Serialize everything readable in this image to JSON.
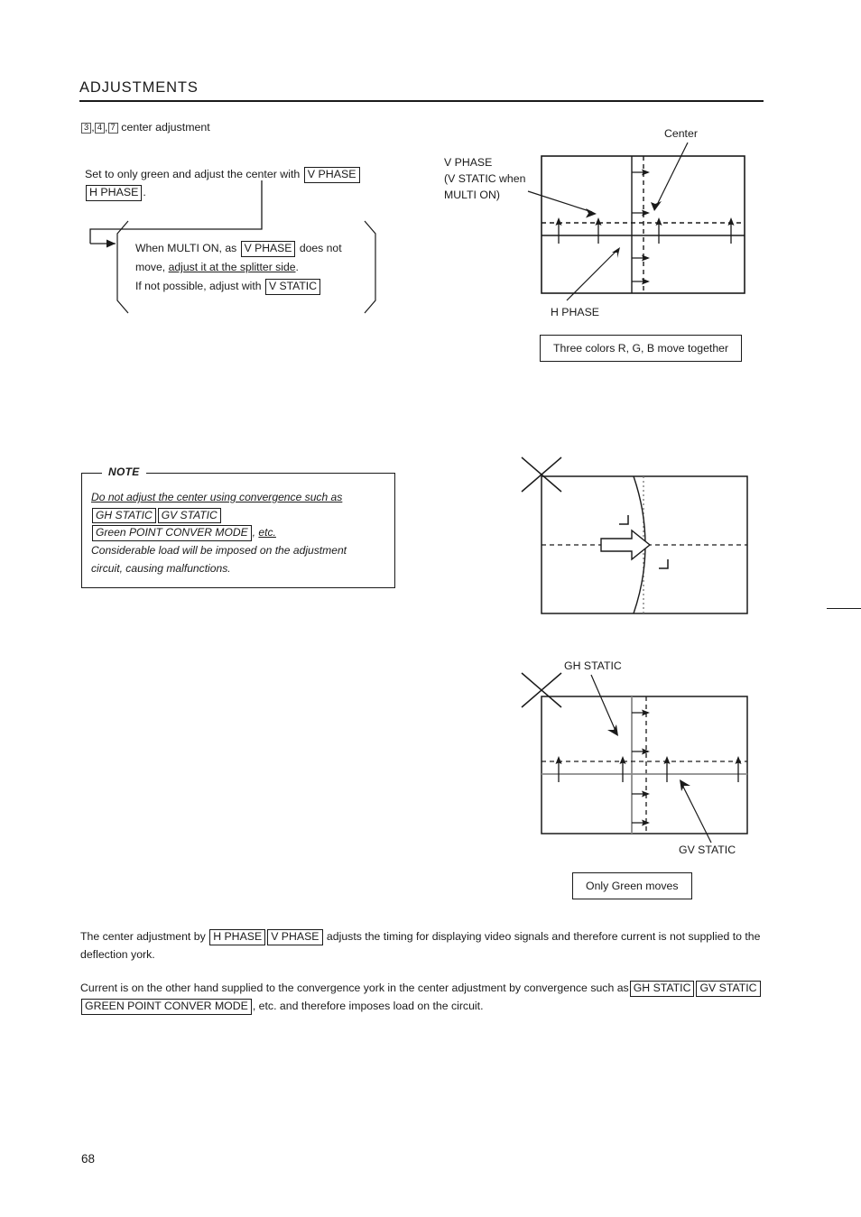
{
  "header": {
    "title": "ADJUSTMENTS"
  },
  "step": {
    "num1": "3",
    "num2": "4",
    "num3": "7",
    "sep": ",",
    "label": "center adjustment"
  },
  "instruction": {
    "lead": "Set to only green and adjust the center with",
    "term_v_phase": "V PHASE",
    "term_h_phase": "H PHASE",
    "period": "."
  },
  "callout": {
    "line1_a": "When MULTI ON, as",
    "line1_term": "V PHASE",
    "line1_b": "does not",
    "line2_a": "move,",
    "line2_underlined": "adjust it at the splitter side",
    "line2_b": ".",
    "line3_a": "If not possible, adjust with",
    "line3_term": "V STATIC"
  },
  "note": {
    "legend": "NOTE",
    "line1": "Do not adjust the center using convergence such as",
    "term1": "GH STATIC",
    "term2": "GV STATIC",
    "term3": "Green POINT CONVER MODE",
    "after_term3": ",",
    "etc": "etc.",
    "line4": "Considerable load will be imposed on the adjustment",
    "line5": "circuit, causing malfunctions."
  },
  "figures": {
    "top": {
      "label_center": "Center",
      "label_vphase_l1": "V PHASE",
      "label_vphase_l2": "(V STATIC when",
      "label_vphase_l3": "MULTI ON)",
      "label_hphase": "H PHASE",
      "caption": "Three colors R, G, B move together"
    },
    "middle": {
      "cross_mark": "x-mark"
    },
    "bottom": {
      "label_gh_static": "GH STATIC",
      "label_gv_static": "GV STATIC",
      "caption": "Only Green moves"
    }
  },
  "paragraphs": {
    "p1_a": "The center adjustment by",
    "p1_term1": "H PHASE",
    "p1_term2": "V PHASE",
    "p1_b": "adjusts the timing for displaying video signals and therefore current is not supplied to the deflection york.",
    "p2_a": "Current is on the other hand supplied to the convergence york in the center adjustment by convergence such as",
    "p2_term1": "GH STATIC",
    "p2_term2": "GV STATIC",
    "p2_term3": "GREEN POINT CONVER MODE",
    "p2_b": ", etc. and therefore imposes load on the circuit."
  },
  "footer": {
    "page_number": "68"
  },
  "colors": {
    "ink": "#1a1a1a",
    "green_line": "#8a8a8a",
    "dotted": "#1a1a1a"
  }
}
